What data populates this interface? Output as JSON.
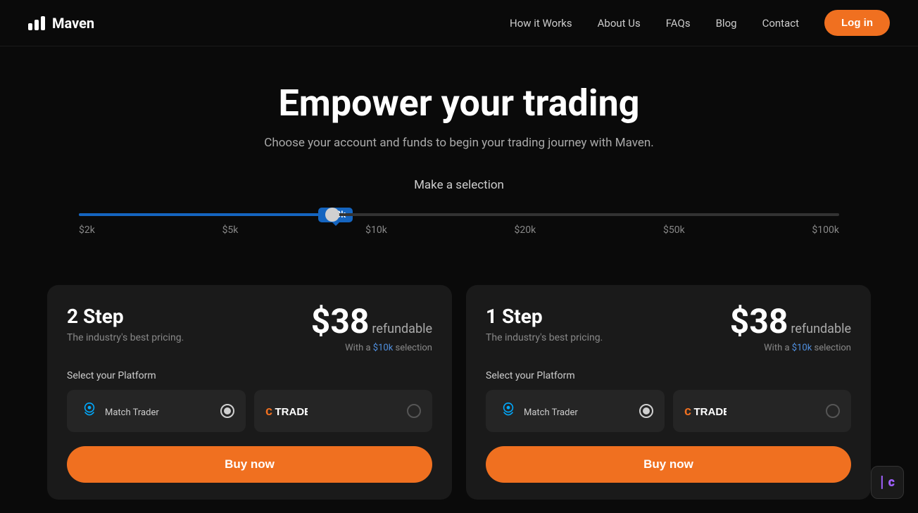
{
  "nav": {
    "logo_text": "Maven",
    "links": [
      {
        "label": "How it Works",
        "id": "how-it-works"
      },
      {
        "label": "About Us",
        "id": "about-us"
      },
      {
        "label": "FAQs",
        "id": "faqs"
      },
      {
        "label": "Blog",
        "id": "blog"
      },
      {
        "label": "Contact",
        "id": "contact"
      }
    ],
    "login_label": "Log in"
  },
  "hero": {
    "title": "Empower your trading",
    "subtitle": "Choose your account and funds to begin your trading journey with Maven."
  },
  "slider": {
    "label": "Make a selection",
    "tooltip": "$10k",
    "ticks": [
      "$2k",
      "$5k",
      "$10k",
      "$20k",
      "$50k",
      "$100k"
    ],
    "current_value": "$10k",
    "fill_percent": 33.33
  },
  "cards": [
    {
      "id": "two-step",
      "title": "2 Step",
      "subtitle": "The industry's best pricing.",
      "price": "$38",
      "price_label": "refundable",
      "price_note_prefix": "With a ",
      "price_note_link": "$10k",
      "price_note_suffix": " selection",
      "platform_label": "Select your Platform",
      "platforms": [
        {
          "name": "Match Trader",
          "type": "match-trader",
          "selected": true
        },
        {
          "name": "cTrader",
          "type": "ctrader",
          "selected": false
        }
      ],
      "buy_label": "Buy now"
    },
    {
      "id": "one-step",
      "title": "1 Step",
      "subtitle": "The industry's best pricing.",
      "price": "$38",
      "price_label": "refundable",
      "price_note_prefix": "With a ",
      "price_note_link": "$10k",
      "price_note_suffix": " selection",
      "platform_label": "Select your Platform",
      "platforms": [
        {
          "name": "Match Trader",
          "type": "match-trader",
          "selected": true
        },
        {
          "name": "cTrader",
          "type": "ctrader",
          "selected": false
        }
      ],
      "buy_label": "Buy now"
    }
  ],
  "widget": {
    "icon": "lc-icon",
    "text": "LC"
  }
}
